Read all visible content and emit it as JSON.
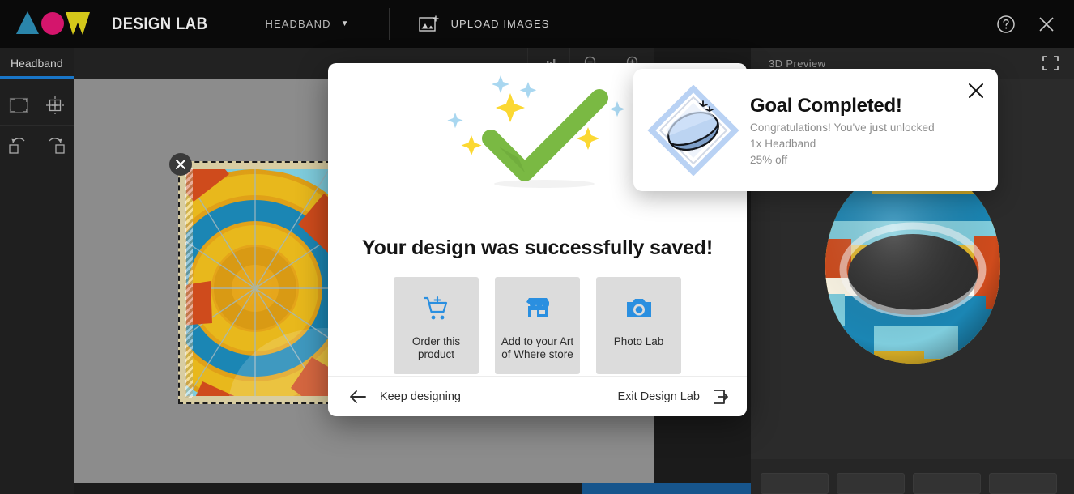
{
  "app": {
    "brand": "DESIGN LAB",
    "logo_colors": {
      "triangle": "#2a85aa",
      "circle": "#d4156c",
      "w": "#d4c81a"
    }
  },
  "topbar": {
    "product_label": "HEADBAND",
    "product_caret": "▼",
    "upload_label": "UPLOAD IMAGES",
    "upload_icon": "image-plus-icon",
    "help_icon": "help-circle-icon",
    "close_icon": "close-icon"
  },
  "left_panel": {
    "tab_label": "Headband",
    "accent": "#1976c8",
    "tools": [
      {
        "name": "fit-to-screen-icon"
      },
      {
        "name": "center-target-icon"
      },
      {
        "name": "rotate-left-icon"
      },
      {
        "name": "rotate-right-icon"
      }
    ]
  },
  "canvas": {
    "delete_icon": "close-icon",
    "design_name": "hot-air-balloon-pattern"
  },
  "right_panel": {
    "title": "3D Preview",
    "expand_icon": "fullscreen-icon",
    "thumbnails": 4
  },
  "modal": {
    "hero_icon": "green-checkmark-sparkles",
    "title": "Your design was successfully saved!",
    "actions": [
      {
        "icon": "add-to-cart-icon",
        "label": "Order this product"
      },
      {
        "icon": "storefront-icon",
        "label": "Add to your Art of Where store"
      },
      {
        "icon": "camera-icon",
        "label": "Photo Lab"
      }
    ],
    "footer": {
      "back_icon": "arrow-left-icon",
      "back_label": "Keep designing",
      "exit_label": "Exit Design Lab",
      "exit_icon": "logout-icon"
    },
    "accent": "#2a8fe0"
  },
  "toast": {
    "badge_icon": "headband-reward-badge",
    "title": "Goal Completed!",
    "line1": "Congratulations! You've just unlocked",
    "line2": "1x Headband",
    "line3": "25% off",
    "close_icon": "close-icon"
  }
}
